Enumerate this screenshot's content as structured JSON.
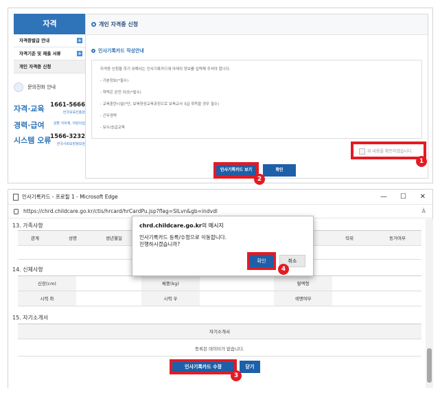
{
  "top_panel": {
    "sidebar": {
      "title": "자격",
      "items": [
        {
          "label": "자격증발급 안내",
          "plus": "+"
        },
        {
          "label": "자격기준 및 제출 서류",
          "plus": "+"
        },
        {
          "label": "개인 자격증 신청"
        }
      ]
    },
    "contact": {
      "heading": "문의전화 안내",
      "rows": [
        {
          "label": "자격·교육",
          "number": "1661-5666",
          "sub": "한국보육진흥원"
        },
        {
          "label": "경력·급여",
          "number": "",
          "sub": "관할 지자체, 어린이집"
        },
        {
          "label": "시스템 오류",
          "number": "1566-3232",
          "sub": "한국사회보장정보원"
        }
      ]
    },
    "main": {
      "header": "개인 자격증 신청",
      "subheader": "인사기록카드 작성안내",
      "intro": "자격증 신청을 하기 위해서는 인사기록카드에 아래의 정보를 입력해 주셔야 합니다.",
      "items": [
        "- 기본정보(*필수)",
        "- 학력은 완전 이상(*필수)",
        "- 교육훈련시설(*단, 보육양성교육과정으로 보육교사 3급 취득할 경우 필수)",
        "- 근무경력",
        "- 보수/승급교육"
      ],
      "agree_label": "위 내용을 확인하였습니다.",
      "view_button": "인사기록카드 보기",
      "confirm_button": "확인"
    },
    "badges": {
      "b1": "1",
      "b2": "2"
    }
  },
  "bottom_window": {
    "title": "인사기록카드 - 프로필 1 - Microsoft Edge",
    "url": "https://chrd.childcare.go.kr/ctis/hrcard/hrCardPu.jsp?flag=SlLvn&gb=indvdl",
    "win_controls": {
      "min": "—",
      "max": "☐",
      "close": "✕"
    },
    "aa": "À",
    "section13": {
      "title": "13. 가족사항",
      "headers": [
        "관계",
        "성명",
        "생년월일",
        "",
        "",
        "",
        "직위",
        "동거여부"
      ]
    },
    "section14": {
      "title": "14. 신체사항",
      "rows": [
        [
          "신장(cm)",
          "",
          "체중(kg)",
          "",
          "혈액형",
          ""
        ],
        [
          "시력 좌",
          "",
          "시력 우",
          "",
          "색맹여부",
          ""
        ]
      ]
    },
    "section15": {
      "title": "15. 자기소개서",
      "header": "자기소개서",
      "empty": "등록된 데이터가 없습니다."
    },
    "edit_button": "인사기록카드 수정",
    "close_button": "닫기",
    "dialog": {
      "title_site": "chrd.childcare.go.kr",
      "title_suffix": "의 메시지",
      "line1": "인사기록카드 등록/수정으로 이동합니다.",
      "line2": "진행하시겠습니까?",
      "ok": "확인",
      "cancel": "취소"
    },
    "badges": {
      "b3": "3",
      "b4": "4"
    }
  },
  "colors": {
    "accent": "#1d5fa8",
    "highlight": "#e31b23",
    "sidebar": "#2f73b9"
  }
}
